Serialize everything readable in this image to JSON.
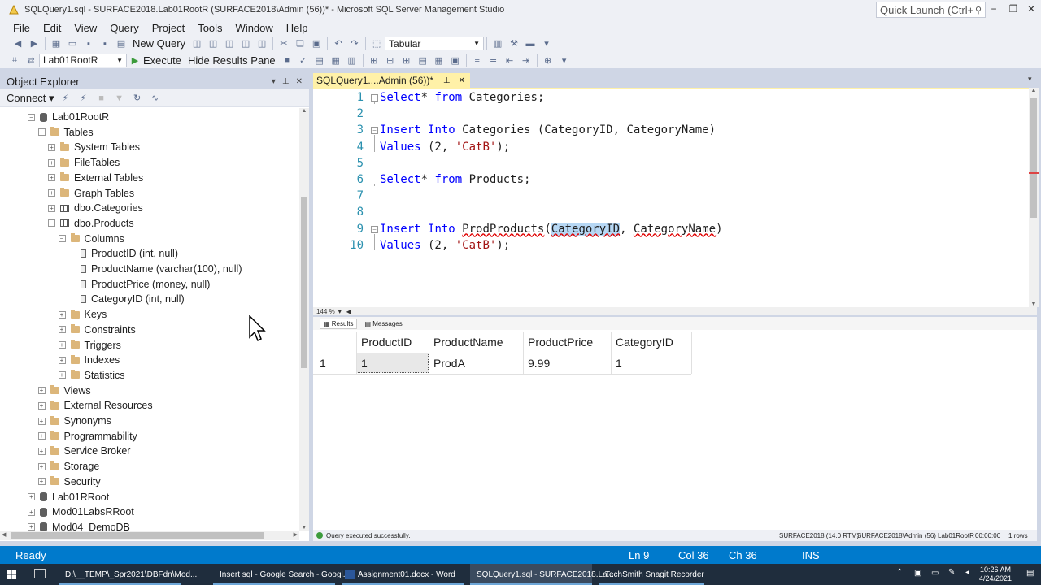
{
  "titlebar": {
    "title": "SQLQuery1.sql - SURFACE2018.Lab01RootR (SURFACE2018\\Admin (56))* - Microsoft SQL Server Management Studio",
    "quick_launch_placeholder": "Quick Launch (Ctrl+"
  },
  "menu": [
    "File",
    "Edit",
    "View",
    "Query",
    "Project",
    "Tools",
    "Window",
    "Help"
  ],
  "toolbar1": {
    "new_query": "New Query",
    "results_mode": "Tabular"
  },
  "toolbar2": {
    "database": "Lab01RootR",
    "execute": "Execute",
    "hide_results": "Hide Results Pane"
  },
  "object_explorer": {
    "title": "Object Explorer",
    "connect": "Connect",
    "tree": [
      {
        "label": "Lab01RootR",
        "depth": 0,
        "icon": "db",
        "exp": "−"
      },
      {
        "label": "Tables",
        "depth": 1,
        "icon": "folder",
        "exp": "−"
      },
      {
        "label": "System Tables",
        "depth": 2,
        "icon": "folder",
        "exp": "+"
      },
      {
        "label": "FileTables",
        "depth": 2,
        "icon": "folder",
        "exp": "+"
      },
      {
        "label": "External Tables",
        "depth": 2,
        "icon": "folder",
        "exp": "+"
      },
      {
        "label": "Graph Tables",
        "depth": 2,
        "icon": "folder",
        "exp": "+"
      },
      {
        "label": "dbo.Categories",
        "depth": 2,
        "icon": "table",
        "exp": "+"
      },
      {
        "label": "dbo.Products",
        "depth": 2,
        "icon": "table",
        "exp": "−"
      },
      {
        "label": "Columns",
        "depth": 3,
        "icon": "folder",
        "exp": "−"
      },
      {
        "label": "ProductID (int, null)",
        "depth": 4,
        "icon": "column",
        "exp": ""
      },
      {
        "label": "ProductName (varchar(100), null)",
        "depth": 4,
        "icon": "column",
        "exp": ""
      },
      {
        "label": "ProductPrice (money, null)",
        "depth": 4,
        "icon": "column",
        "exp": ""
      },
      {
        "label": "CategoryID (int, null)",
        "depth": 4,
        "icon": "column",
        "exp": ""
      },
      {
        "label": "Keys",
        "depth": 3,
        "icon": "folder",
        "exp": "+"
      },
      {
        "label": "Constraints",
        "depth": 3,
        "icon": "folder",
        "exp": "+"
      },
      {
        "label": "Triggers",
        "depth": 3,
        "icon": "folder",
        "exp": "+"
      },
      {
        "label": "Indexes",
        "depth": 3,
        "icon": "folder",
        "exp": "+"
      },
      {
        "label": "Statistics",
        "depth": 3,
        "icon": "folder",
        "exp": "+"
      },
      {
        "label": "Views",
        "depth": 1,
        "icon": "folder",
        "exp": "+"
      },
      {
        "label": "External Resources",
        "depth": 1,
        "icon": "folder",
        "exp": "+"
      },
      {
        "label": "Synonyms",
        "depth": 1,
        "icon": "folder",
        "exp": "+"
      },
      {
        "label": "Programmability",
        "depth": 1,
        "icon": "folder",
        "exp": "+"
      },
      {
        "label": "Service Broker",
        "depth": 1,
        "icon": "folder",
        "exp": "+"
      },
      {
        "label": "Storage",
        "depth": 1,
        "icon": "folder",
        "exp": "+"
      },
      {
        "label": "Security",
        "depth": 1,
        "icon": "folder",
        "exp": "+"
      },
      {
        "label": "Lab01RRoot",
        "depth": 0,
        "icon": "db",
        "exp": "+"
      },
      {
        "label": "Mod01LabsRRoot",
        "depth": 0,
        "icon": "db",
        "exp": "+"
      },
      {
        "label": "Mod04_DemoDB",
        "depth": 0,
        "icon": "db",
        "exp": "+"
      }
    ]
  },
  "editor": {
    "tab_label": "SQLQuery1....Admin (56))*",
    "zoom": "144 %",
    "lines": [
      {
        "num": "1",
        "tokens": [
          [
            "kw",
            "Select"
          ],
          [
            "",
            "* "
          ],
          [
            "kw",
            "from"
          ],
          [
            "",
            " Categories;"
          ]
        ]
      },
      {
        "num": "2",
        "tokens": []
      },
      {
        "num": "3",
        "tokens": [
          [
            "kw",
            "Insert"
          ],
          [
            "",
            " "
          ],
          [
            "kw",
            "Into"
          ],
          [
            "",
            " Categories (CategoryID, CategoryName)"
          ]
        ]
      },
      {
        "num": "4",
        "tokens": [
          [
            "kw",
            "Values"
          ],
          [
            "",
            " (2, "
          ],
          [
            "str",
            "'CatB'"
          ],
          [
            "",
            ");"
          ]
        ]
      },
      {
        "num": "5",
        "tokens": []
      },
      {
        "num": "6",
        "tokens": [
          [
            "kw",
            "Select"
          ],
          [
            "",
            "* "
          ],
          [
            "kw",
            "from"
          ],
          [
            "",
            " Products;"
          ]
        ]
      },
      {
        "num": "7",
        "tokens": []
      },
      {
        "num": "8",
        "tokens": []
      },
      {
        "num": "9",
        "tokens": [
          [
            "kw",
            "Insert"
          ],
          [
            "",
            " "
          ],
          [
            "kw",
            "Into"
          ],
          [
            "",
            " "
          ],
          [
            "sq",
            "ProdProducts"
          ],
          [
            "",
            "("
          ],
          [
            "sel",
            "CategoryID"
          ],
          [
            "",
            ", "
          ],
          [
            "sq",
            "CategoryName"
          ],
          [
            "",
            ")"
          ]
        ]
      },
      {
        "num": "10",
        "tokens": [
          [
            "kw",
            "Values"
          ],
          [
            "",
            " (2, "
          ],
          [
            "str",
            "'CatB'"
          ],
          [
            "",
            ");"
          ]
        ]
      }
    ]
  },
  "results": {
    "tab_results": "Results",
    "tab_messages": "Messages",
    "columns": [
      "ProductID",
      "ProductName",
      "ProductPrice",
      "CategoryID"
    ],
    "rows": [
      {
        "rownum": "1",
        "cells": [
          "1",
          "ProdA",
          "9.99",
          "1"
        ]
      }
    ],
    "status": "Query executed successfully.",
    "server": "SURFACE2018 (14.0 RTM)",
    "user": "SURFACE2018\\Admin (56)",
    "db": "Lab01RootR",
    "time": "00:00:00",
    "rowcount": "1 rows"
  },
  "statusbar": {
    "ready": "Ready",
    "ln": "Ln 9",
    "col": "Col 36",
    "ch": "Ch 36",
    "ins": "INS"
  },
  "taskbar": {
    "tasks": [
      {
        "label": "D:\\__TEMP\\_Spr2021\\DBFdn\\Mod...",
        "icon_color": "#f2c94c"
      },
      {
        "label": "Insert sql - Google Search - Googl...",
        "icon_color": "#34a853"
      },
      {
        "label": "Assignment01.docx - Word",
        "icon_color": "#2b579a"
      },
      {
        "label": "SQLQuery1.sql - SURFACE2018.La...",
        "icon_color": "#d9a520"
      },
      {
        "label": "TechSmith Snagit Recorder",
        "icon_color": "#e03c31"
      }
    ],
    "time": "10:26 AM",
    "date": "4/24/2021"
  },
  "colors": {
    "accent": "#007acc",
    "tab_active": "#fff1a8",
    "keyword": "#0000ff",
    "string": "#a31515"
  }
}
